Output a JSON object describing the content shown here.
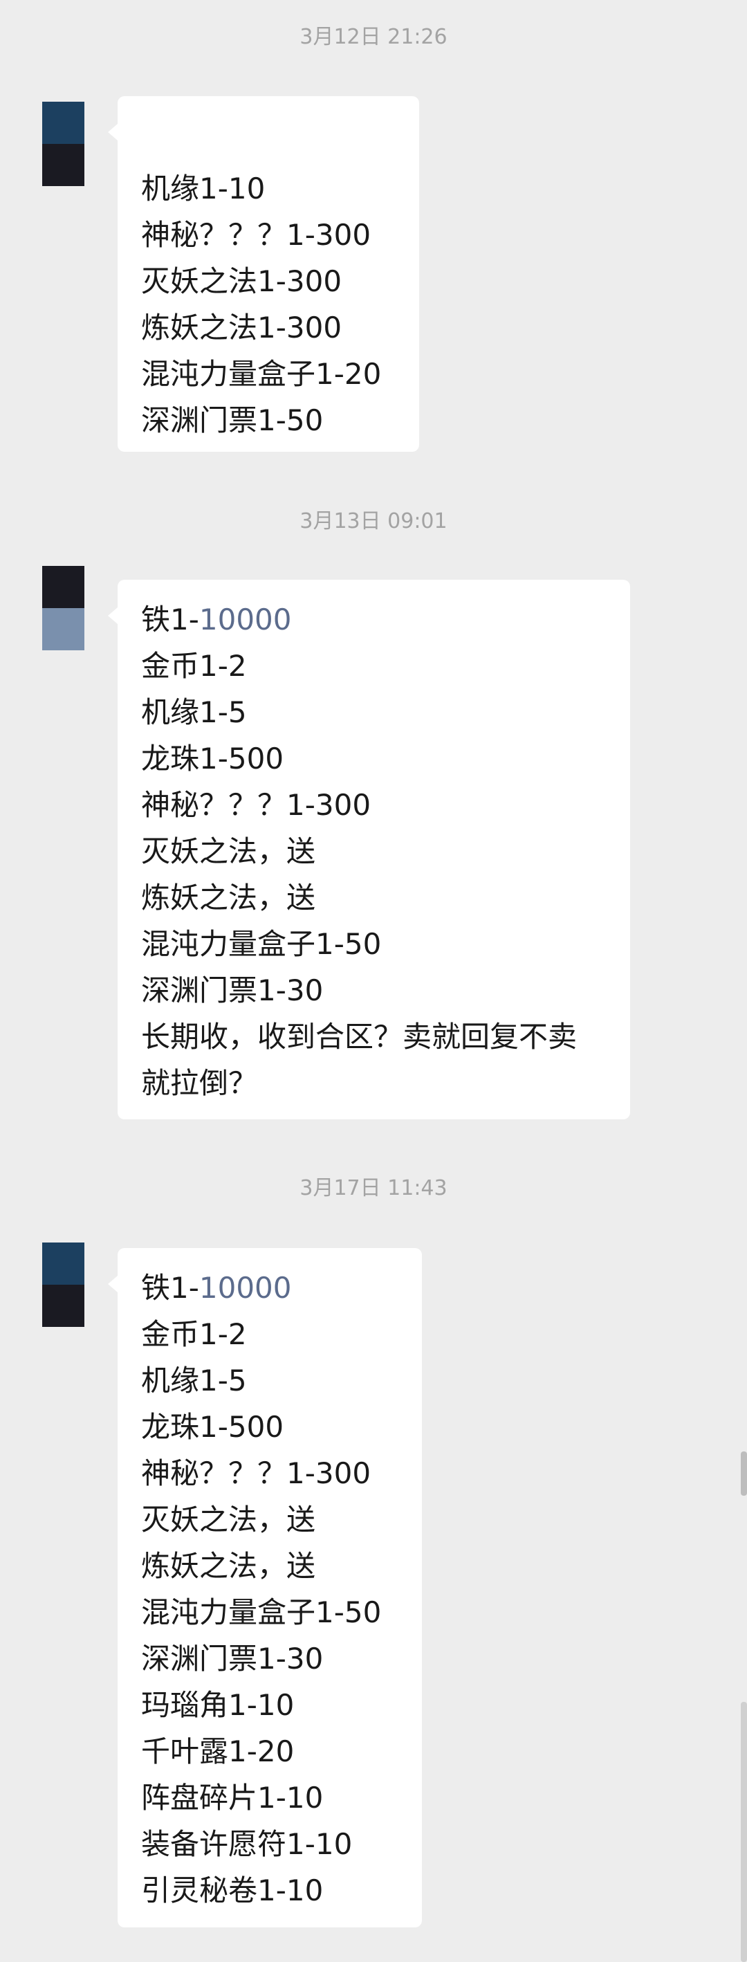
{
  "messages": [
    {
      "timestamp": "3月12日 21:26",
      "avatar_colors": [
        "#1c4060",
        "#1a1a22"
      ],
      "lines": [
        "机缘1-10",
        "神秘？？？1-300",
        "灭妖之法1-300",
        "炼妖之法1-300",
        "混沌力量盒子1-20",
        "深渊门票1-50"
      ]
    },
    {
      "timestamp": "3月13日 09:01",
      "avatar_colors": [
        "#1a1a22",
        "#7a90ad"
      ],
      "first_line_prefix": "铁1-",
      "first_line_link": "10000",
      "lines": [
        "金币1-2",
        "机缘1-5",
        "龙珠1-500",
        "神秘？？？1-300",
        "灭妖之法，送",
        "炼妖之法，送",
        "混沌力量盒子1-50",
        "深渊门票1-30",
        "长期收，收到合区？卖就回复不卖",
        "就拉倒？"
      ]
    },
    {
      "timestamp": "3月17日 11:43",
      "avatar_colors": [
        "#1c4060",
        "#1a1a22"
      ],
      "first_line_prefix": "铁1-",
      "first_line_link": "10000",
      "lines": [
        "金币1-2",
        "机缘1-5",
        "龙珠1-500",
        "神秘？？？1-300",
        "灭妖之法，送",
        "炼妖之法，送",
        "混沌力量盒子1-50",
        "深渊门票1-30",
        "玛瑙角1-10",
        "千叶露1-20",
        "阵盘碎片1-10",
        "装备许愿符1-10",
        "引灵秘卷1-10"
      ]
    }
  ]
}
